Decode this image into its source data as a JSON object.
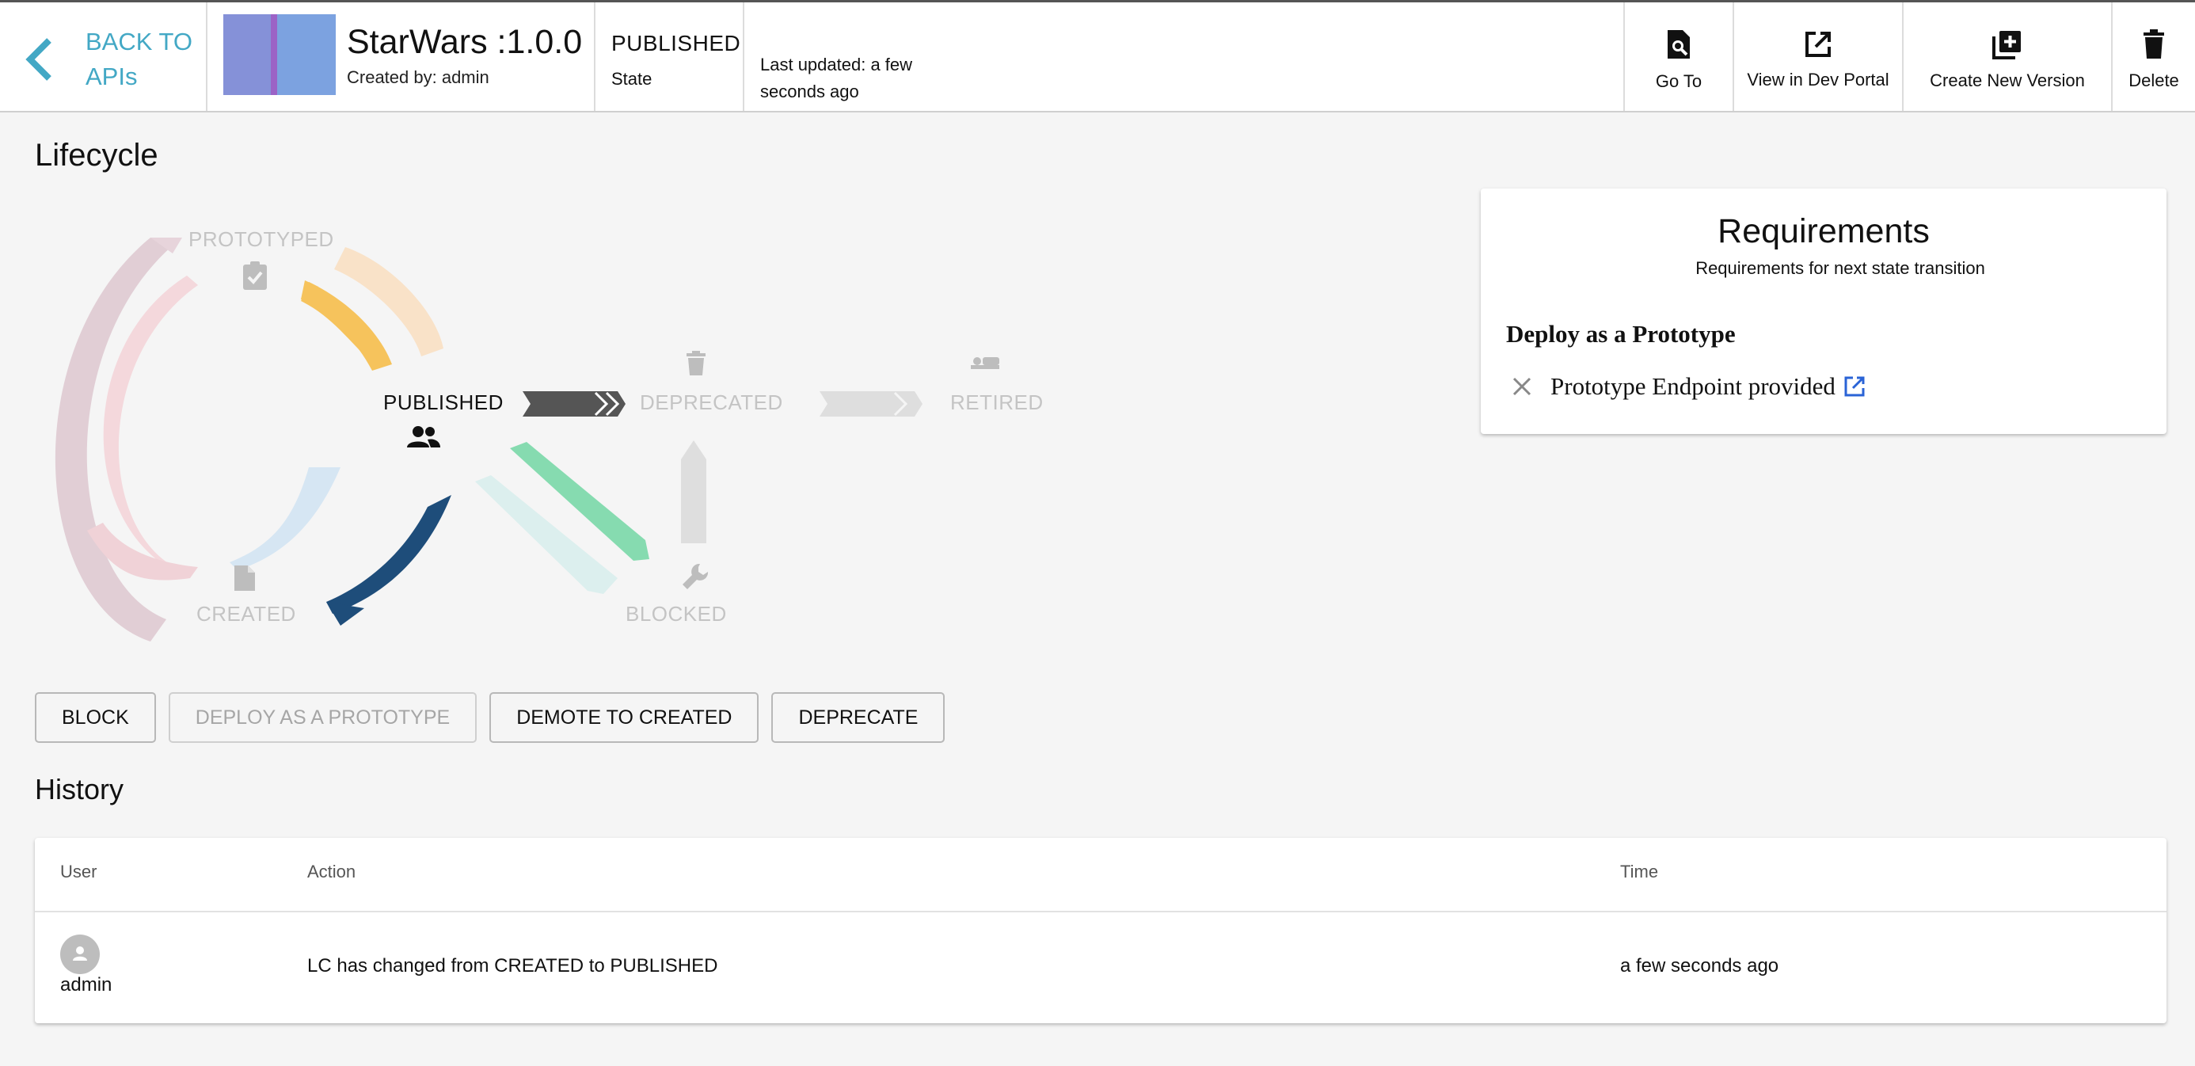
{
  "header": {
    "back_label": "BACK TO APIs",
    "api_title": "StarWars :1.0.0",
    "created_by": "Created by: admin",
    "state_value": "PUBLISHED",
    "state_label": "State",
    "last_updated": "Last updated: a few seconds ago",
    "actions": [
      {
        "label": "Go To",
        "icon": "search-doc-icon"
      },
      {
        "label": "View in Dev Portal",
        "icon": "external-link-icon"
      },
      {
        "label": "Create New Version",
        "icon": "library-add-icon"
      },
      {
        "label": "Delete",
        "icon": "trash-icon"
      }
    ]
  },
  "lifecycle": {
    "title": "Lifecycle",
    "states": {
      "prototyped": "PROTOTYPED",
      "published": "PUBLISHED",
      "deprecated": "DEPRECATED",
      "retired": "RETIRED",
      "created": "CREATED",
      "blocked": "BLOCKED"
    },
    "current_state": "PUBLISHED"
  },
  "requirements": {
    "title": "Requirements",
    "subtitle": "Requirements for next state transition",
    "heading": "Deploy as a Prototype",
    "items": [
      {
        "label": "Prototype Endpoint provided",
        "met": false
      }
    ]
  },
  "buttons": [
    {
      "label": "BLOCK",
      "enabled": true
    },
    {
      "label": "DEPLOY AS A PROTOTYPE",
      "enabled": false
    },
    {
      "label": "DEMOTE TO CREATED",
      "enabled": true
    },
    {
      "label": "DEPRECATE",
      "enabled": true
    }
  ],
  "history": {
    "title": "History",
    "columns": [
      "User",
      "Action",
      "Time"
    ],
    "rows": [
      {
        "user": "admin",
        "action": "LC has changed from CREATED to PUBLISHED",
        "time": "a few seconds ago"
      }
    ]
  },
  "colors": {
    "accent": "#43a8c5",
    "published_arrow": "#555555",
    "demote_arrow": "#1e4d7a",
    "prototype_arrow": "#f6c35c",
    "block_arrow": "#86dbb0"
  }
}
